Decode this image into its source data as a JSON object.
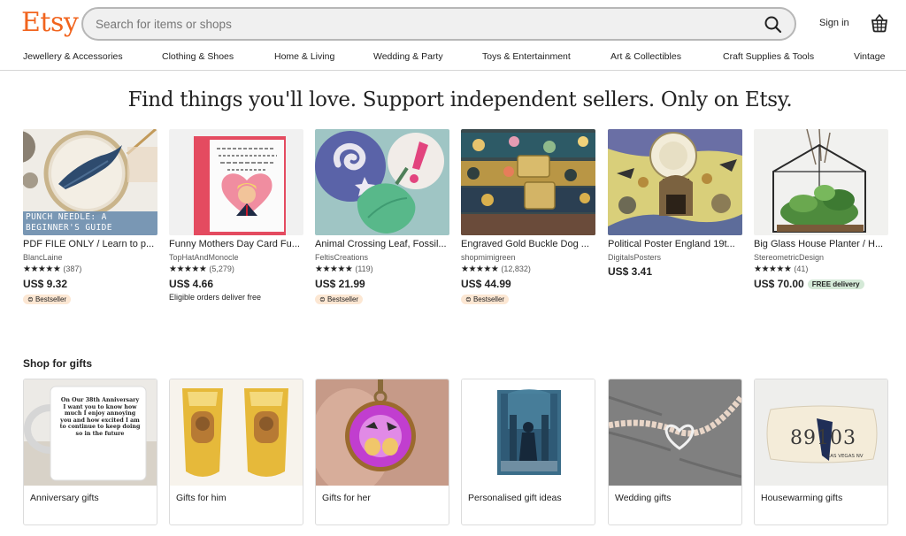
{
  "header": {
    "logo": "Etsy",
    "search_placeholder": "Search for items or shops",
    "signin_label": "Sign in"
  },
  "categories": [
    "Jewellery & Accessories",
    "Clothing & Shoes",
    "Home & Living",
    "Wedding & Party",
    "Toys & Entertainment",
    "Art & Collectibles",
    "Craft Supplies & Tools",
    "Vintage"
  ],
  "hero": {
    "text": "Find things you'll love. Support independent sellers. Only on Etsy."
  },
  "products": [
    {
      "title": "PDF FILE ONLY / Learn to p...",
      "shop": "BlancLaine",
      "stars": "★★★★★",
      "count": "(387)",
      "price": "US$ 9.32",
      "badge": "Bestseller",
      "image_caption": "PUNCH NEEDLE: A BEGINNER'S GUIDE"
    },
    {
      "title": "Funny Mothers Day Card Fu...",
      "shop": "TopHatAndMonocle",
      "stars": "★★★★★",
      "count": "(5,279)",
      "price": "US$ 4.66",
      "note": "Eligible orders deliver free"
    },
    {
      "title": "Animal Crossing Leaf, Fossil...",
      "shop": "FeltisCreations",
      "stars": "★★★★★",
      "count": "(119)",
      "price": "US$ 21.99",
      "badge": "Bestseller"
    },
    {
      "title": "Engraved Gold Buckle Dog ...",
      "shop": "shopmimigreen",
      "stars": "★★★★★",
      "count": "(12,832)",
      "price": "US$ 44.99",
      "badge": "Bestseller"
    },
    {
      "title": "Political Poster England 19t...",
      "shop": "DigitalsPosters",
      "price": "US$ 3.41"
    },
    {
      "title": "Big Glass House Planter / H...",
      "shop": "StereometricDesign",
      "stars": "★★★★★",
      "count": "(41)",
      "price": "US$ 70.00",
      "delivery_badge": "FREE delivery"
    }
  ],
  "gifts": {
    "title": "Shop for gifts",
    "items": [
      {
        "label": "Anniversary gifts",
        "mug_text": "On Our 38th Anniversary I want you to know how much I enjoy annoying you and how excited I am to continue to keep doing so in the future"
      },
      {
        "label": "Gifts for him"
      },
      {
        "label": "Gifts for her"
      },
      {
        "label": "Personalised gift ideas"
      },
      {
        "label": "Wedding gifts"
      },
      {
        "label": "Housewarming gifts",
        "pillow_text": "89103",
        "pillow_sub": "LAS VEGAS NV"
      }
    ]
  },
  "colors": {
    "brand": "#F1641E",
    "bestseller_bg": "#fce7d3",
    "free_delivery_bg": "#d4e9d7"
  }
}
